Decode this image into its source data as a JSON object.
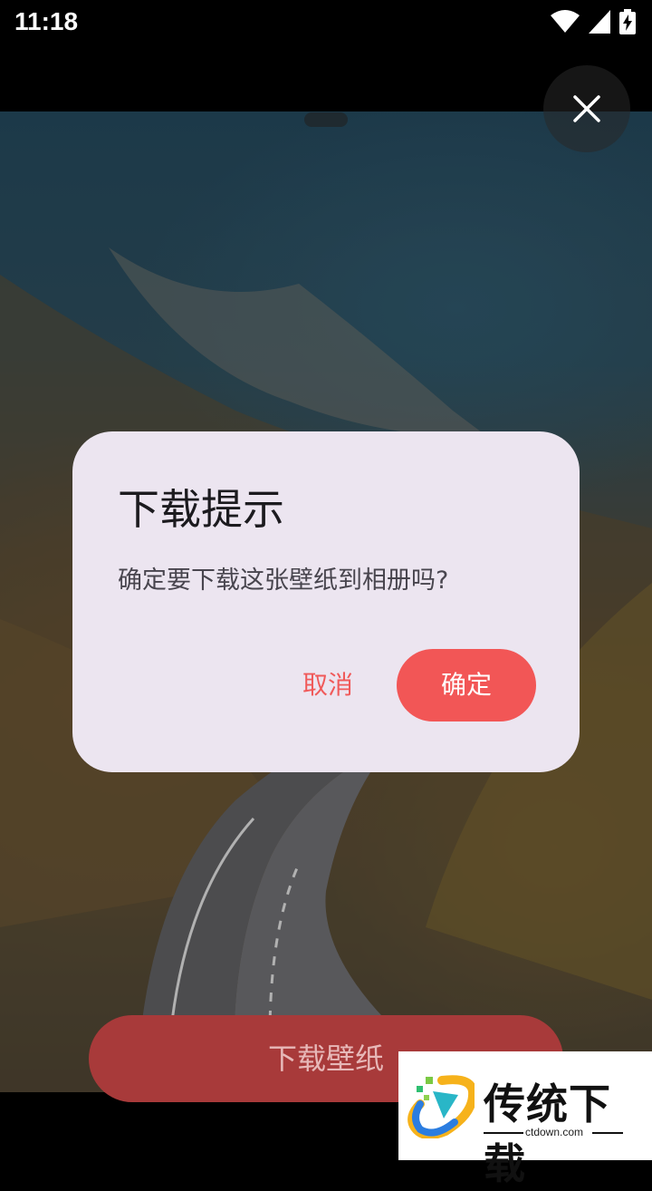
{
  "status_bar": {
    "time": "11:18",
    "icons": [
      "wifi-icon",
      "cellular-signal-icon",
      "battery-charging-icon"
    ]
  },
  "close_button": {
    "icon": "close-icon"
  },
  "dialog": {
    "title": "下载提示",
    "message": "确定要下载这张壁纸到相册吗?",
    "cancel_label": "取消",
    "confirm_label": "确定"
  },
  "download_button": {
    "label": "下载壁纸"
  },
  "watermark": {
    "title": "传统下载",
    "url": "ctdown.com"
  },
  "colors": {
    "accent": "#f25656",
    "dialog_bg": "#ece5f0",
    "download_button_bg": "#a83a3a"
  }
}
